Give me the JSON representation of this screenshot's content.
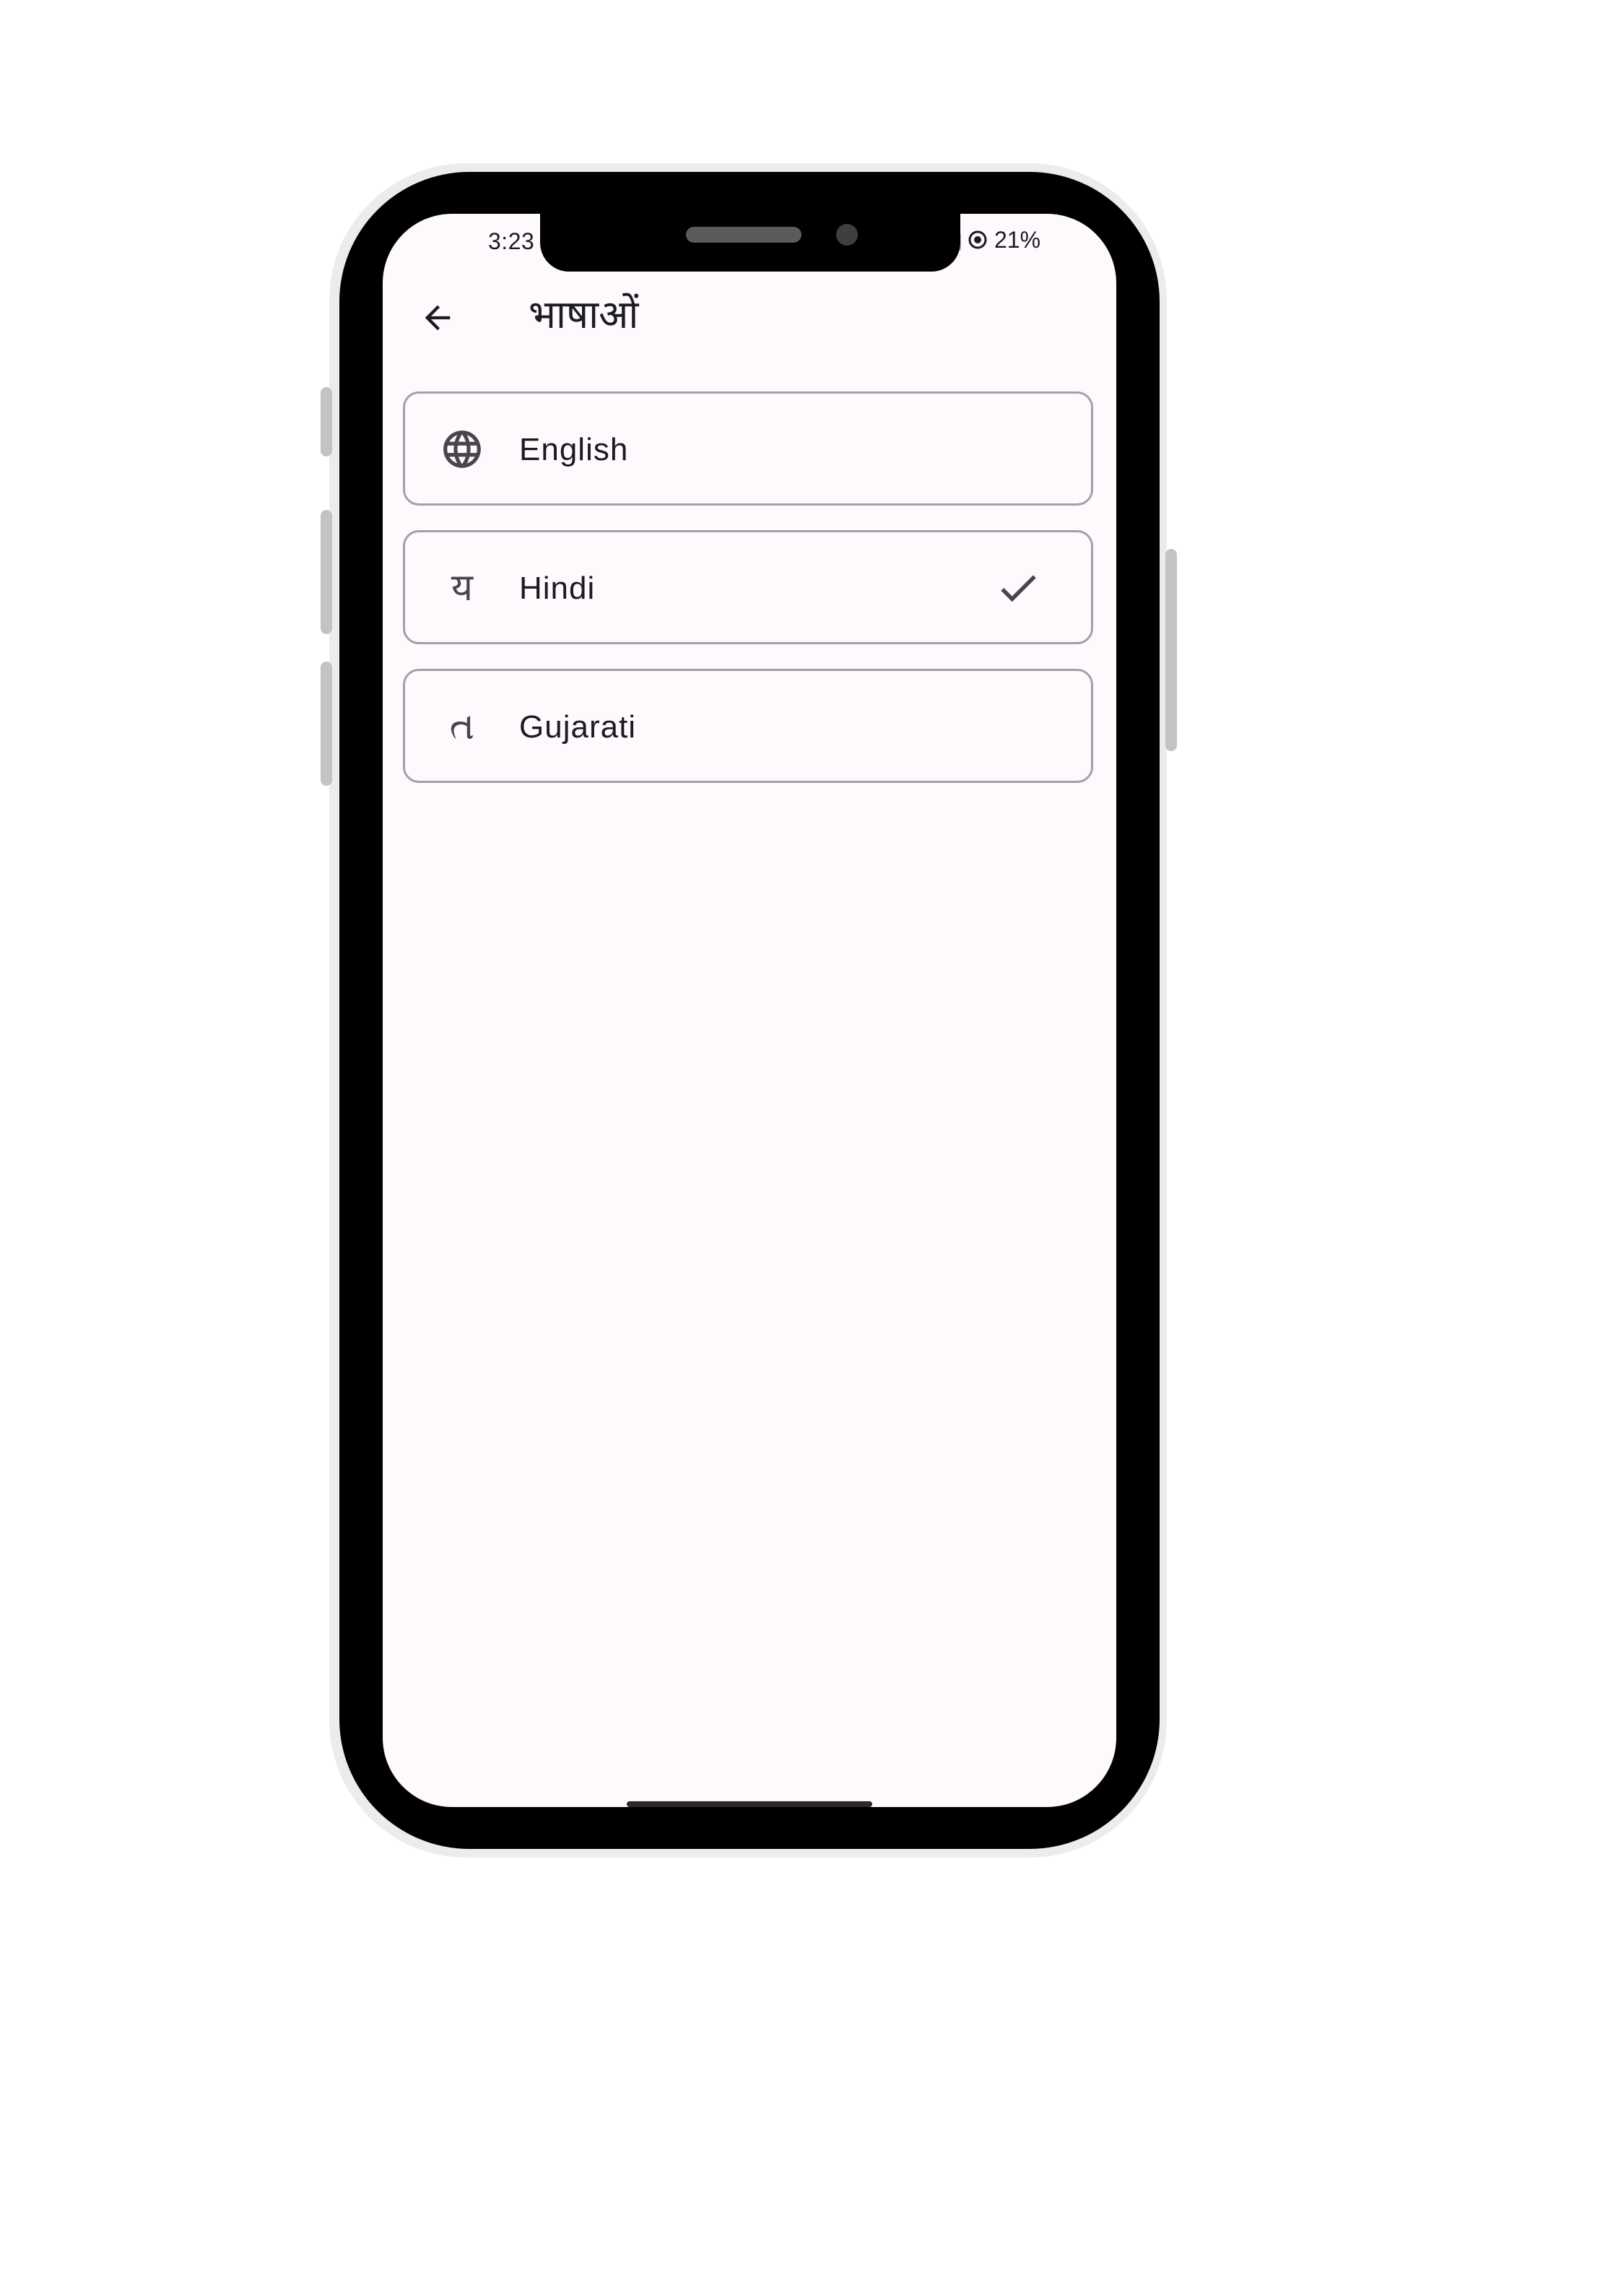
{
  "status_bar": {
    "time": "3:23",
    "battery": "21%",
    "icons": [
      "signal-icon",
      "sync-icon"
    ]
  },
  "app_bar": {
    "back_icon": "arrow-back-icon",
    "title": "भाषाओं"
  },
  "languages": [
    {
      "icon": "globe-icon",
      "glyph": "",
      "label": "English",
      "selected": false
    },
    {
      "icon": "hindi-glyph-icon",
      "glyph": "य",
      "label": "Hindi",
      "selected": true
    },
    {
      "icon": "gujarati-glyph-icon",
      "glyph": "ત",
      "label": "Gujarati",
      "selected": false
    }
  ],
  "colors": {
    "screen_background": "#fdf9fc",
    "item_border": "#a3a0a6",
    "icon": "#49454f",
    "text": "#1c1b1f"
  }
}
